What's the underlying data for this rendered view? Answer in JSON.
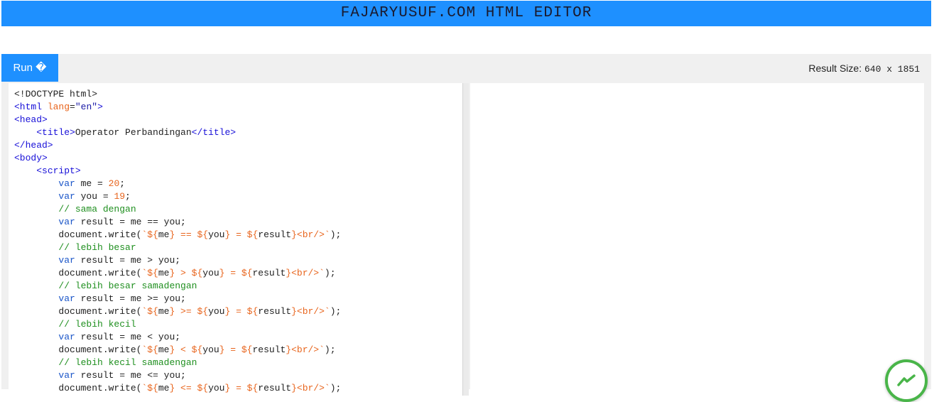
{
  "header": {
    "title": "FAJARYUSUF.COM HTML EDITOR"
  },
  "toolbar": {
    "run_label": "Run �",
    "result_size_label": "Result Size:",
    "result_size_value": "640 x 1851"
  },
  "editor": {
    "lines": [
      [
        {
          "t": "<!DOCTYPE html>",
          "c": "plain"
        }
      ],
      [
        {
          "t": "<html ",
          "c": "tag"
        },
        {
          "t": "lang",
          "c": "attr"
        },
        {
          "t": "=",
          "c": "plain"
        },
        {
          "t": "\"en\"",
          "c": "str"
        },
        {
          "t": ">",
          "c": "tag"
        }
      ],
      [
        {
          "t": "<head>",
          "c": "tag"
        }
      ],
      [
        {
          "t": "    ",
          "c": "plain"
        },
        {
          "t": "<title>",
          "c": "tag"
        },
        {
          "t": "Operator Perbandingan",
          "c": "plain"
        },
        {
          "t": "</title>",
          "c": "tag"
        }
      ],
      [
        {
          "t": "</head>",
          "c": "tag"
        }
      ],
      [
        {
          "t": "<body>",
          "c": "tag"
        }
      ],
      [
        {
          "t": "    ",
          "c": "plain"
        },
        {
          "t": "<script>",
          "c": "tag"
        }
      ],
      [
        {
          "t": "        ",
          "c": "plain"
        },
        {
          "t": "var",
          "c": "kw"
        },
        {
          "t": " me = ",
          "c": "plain"
        },
        {
          "t": "20",
          "c": "num"
        },
        {
          "t": ";",
          "c": "plain"
        }
      ],
      [
        {
          "t": "        ",
          "c": "plain"
        },
        {
          "t": "var",
          "c": "kw"
        },
        {
          "t": " you = ",
          "c": "plain"
        },
        {
          "t": "19",
          "c": "num"
        },
        {
          "t": ";",
          "c": "plain"
        }
      ],
      [
        {
          "t": "        ",
          "c": "plain"
        },
        {
          "t": "// sama dengan",
          "c": "cm"
        }
      ],
      [
        {
          "t": "        ",
          "c": "plain"
        },
        {
          "t": "var",
          "c": "kw"
        },
        {
          "t": " result = me == you;",
          "c": "plain"
        }
      ],
      [
        {
          "t": "        document.write(",
          "c": "plain"
        },
        {
          "t": "`${",
          "c": "str2"
        },
        {
          "t": "me",
          "c": "plain"
        },
        {
          "t": "} == ${",
          "c": "str2"
        },
        {
          "t": "you",
          "c": "plain"
        },
        {
          "t": "} = ${",
          "c": "str2"
        },
        {
          "t": "result",
          "c": "plain"
        },
        {
          "t": "}<br/>`",
          "c": "str2"
        },
        {
          "t": ");",
          "c": "plain"
        }
      ],
      [
        {
          "t": "        ",
          "c": "plain"
        },
        {
          "t": "// lebih besar",
          "c": "cm"
        }
      ],
      [
        {
          "t": "        ",
          "c": "plain"
        },
        {
          "t": "var",
          "c": "kw"
        },
        {
          "t": " result = me > you;",
          "c": "plain"
        }
      ],
      [
        {
          "t": "        document.write(",
          "c": "plain"
        },
        {
          "t": "`${",
          "c": "str2"
        },
        {
          "t": "me",
          "c": "plain"
        },
        {
          "t": "} > ${",
          "c": "str2"
        },
        {
          "t": "you",
          "c": "plain"
        },
        {
          "t": "} = ${",
          "c": "str2"
        },
        {
          "t": "result",
          "c": "plain"
        },
        {
          "t": "}<br/>`",
          "c": "str2"
        },
        {
          "t": ");",
          "c": "plain"
        }
      ],
      [
        {
          "t": "        ",
          "c": "plain"
        },
        {
          "t": "// lebih besar samadengan",
          "c": "cm"
        }
      ],
      [
        {
          "t": "        ",
          "c": "plain"
        },
        {
          "t": "var",
          "c": "kw"
        },
        {
          "t": " result = me >= you;",
          "c": "plain"
        }
      ],
      [
        {
          "t": "        document.write(",
          "c": "plain"
        },
        {
          "t": "`${",
          "c": "str2"
        },
        {
          "t": "me",
          "c": "plain"
        },
        {
          "t": "} >= ${",
          "c": "str2"
        },
        {
          "t": "you",
          "c": "plain"
        },
        {
          "t": "} = ${",
          "c": "str2"
        },
        {
          "t": "result",
          "c": "plain"
        },
        {
          "t": "}<br/>`",
          "c": "str2"
        },
        {
          "t": ");",
          "c": "plain"
        }
      ],
      [
        {
          "t": "        ",
          "c": "plain"
        },
        {
          "t": "// lebih kecil",
          "c": "cm"
        }
      ],
      [
        {
          "t": "        ",
          "c": "plain"
        },
        {
          "t": "var",
          "c": "kw"
        },
        {
          "t": " result = me < you;",
          "c": "plain"
        }
      ],
      [
        {
          "t": "        document.write(",
          "c": "plain"
        },
        {
          "t": "`${",
          "c": "str2"
        },
        {
          "t": "me",
          "c": "plain"
        },
        {
          "t": "} < ${",
          "c": "str2"
        },
        {
          "t": "you",
          "c": "plain"
        },
        {
          "t": "} = ${",
          "c": "str2"
        },
        {
          "t": "result",
          "c": "plain"
        },
        {
          "t": "}<br/>`",
          "c": "str2"
        },
        {
          "t": ");",
          "c": "plain"
        }
      ],
      [
        {
          "t": "        ",
          "c": "plain"
        },
        {
          "t": "// lebih kecil samadengan",
          "c": "cm"
        }
      ],
      [
        {
          "t": "        ",
          "c": "plain"
        },
        {
          "t": "var",
          "c": "kw"
        },
        {
          "t": " result = me <= you;",
          "c": "plain"
        }
      ],
      [
        {
          "t": "        document.write(",
          "c": "plain"
        },
        {
          "t": "`${",
          "c": "str2"
        },
        {
          "t": "me",
          "c": "plain"
        },
        {
          "t": "} <= ${",
          "c": "str2"
        },
        {
          "t": "you",
          "c": "plain"
        },
        {
          "t": "} = ${",
          "c": "str2"
        },
        {
          "t": "result",
          "c": "plain"
        },
        {
          "t": "}<br/>`",
          "c": "str2"
        },
        {
          "t": ");",
          "c": "plain"
        }
      ]
    ]
  },
  "colors": {
    "accent": "#1e90ff",
    "tag": "#170fd8",
    "attr": "#e8641c",
    "str": "#1a1aa6",
    "str2": "#e8641c",
    "kw": "#1a55c8",
    "num": "#e8641c",
    "cm": "#1f8f1f",
    "plain": "#222222",
    "chat_ring": "#49b549"
  },
  "icons": {
    "run": "replacement-char-icon",
    "chat": "messenger-icon"
  }
}
